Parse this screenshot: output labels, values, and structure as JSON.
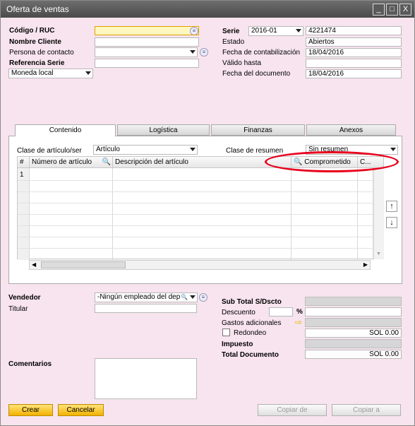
{
  "window": {
    "title": "Oferta de ventas",
    "min": "_",
    "max": "□",
    "close": "X"
  },
  "header_left": {
    "codigo_label": "Código / RUC",
    "nombre_label": "Nombre Cliente",
    "persona_label": "Persona de contacto",
    "referencia_label": "Referencia Serie",
    "moneda_value": "Moneda local"
  },
  "header_right": {
    "serie_label": "Serie",
    "serie_value": "2016-01",
    "serie_number": "4221474",
    "estado_label": "Estado",
    "estado_value": "Abiertos",
    "fecha_contab_label": "Fecha de contabilización",
    "fecha_contab_value": "18/04/2016",
    "valido_label": "Válido hasta",
    "fecha_doc_label": "Fecha del documento",
    "fecha_doc_value": "18/04/2016"
  },
  "tabs": [
    {
      "label": "Contenido"
    },
    {
      "label": "Logística"
    },
    {
      "label": "Finanzas"
    },
    {
      "label": "Anexos"
    }
  ],
  "content": {
    "clase_articulo_label": "Clase de artículo/ser",
    "clase_articulo_value": "Artículo",
    "clase_resumen_label": "Clase de resumen",
    "clase_resumen_value": "Sin resumen"
  },
  "grid": {
    "columns": [
      "#",
      "Número de artículo",
      "Descripción del artículo",
      "Comprometido",
      "C..."
    ],
    "rows": [
      {
        "num": "1"
      }
    ]
  },
  "footer_left": {
    "vendedor_label": "Vendedor",
    "vendedor_value": "-Ningún empleado del dep",
    "titular_label": "Titular",
    "comentarios_label": "Comentarios"
  },
  "footer_right": {
    "subtotal_label": "Sub Total S/Dscto",
    "descuento_label": "Descuento",
    "percent": "%",
    "gastos_label": "Gastos adicionales",
    "redondeo_label": "Redondeo",
    "redondeo_value": "SOL 0.00",
    "impuesto_label": "Impuesto",
    "total_label": "Total Documento",
    "total_value": "SOL 0.00"
  },
  "buttons": {
    "crear": "Crear",
    "cancelar": "Cancelar",
    "copiar_de": "Copiar de",
    "copiar_a": "Copiar a"
  },
  "colors": {
    "background": "#f7e4ee",
    "accent": "#f2b200",
    "highlight": "#e8001c"
  }
}
